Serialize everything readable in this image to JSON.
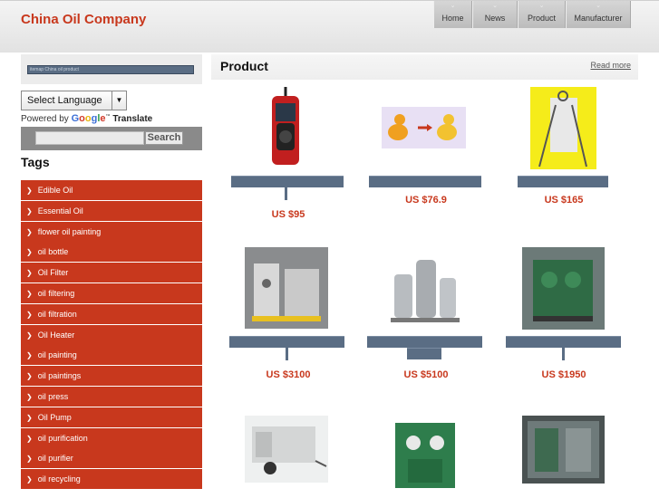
{
  "header": {
    "logo": "China Oil Company",
    "nav": [
      "Home",
      "News",
      "Product",
      "Manufacturer"
    ]
  },
  "sidebar": {
    "search_placeholder": "itemap China oil product",
    "language_select": "Select Language",
    "powered_by": "Powered by",
    "google": "Google",
    "translate": "Translate",
    "search_button": "Search",
    "tags_title": "Tags",
    "tags": [
      "Edible Oil",
      "Essential Oil",
      "flower oil painting",
      "oil bottle",
      "Oil Filter",
      "oil filtering",
      "oil filtration",
      "Oil Heater",
      "oil painting",
      "oil paintings",
      "oil press",
      "Oil Pump",
      "oil purification",
      "oil purifier",
      "oil recycling"
    ]
  },
  "main": {
    "title": "Product",
    "read_more": "Read more",
    "products": [
      {
        "price": "US $95",
        "icon": "obd-scanner-icon"
      },
      {
        "price": "US $76.9",
        "icon": "ducks-icon"
      },
      {
        "price": "US $165",
        "icon": "paper-stand-icon"
      },
      {
        "price": "US $3100",
        "icon": "oil-purifier-icon"
      },
      {
        "price": "US $5100",
        "icon": "oil-filter-machine-icon"
      },
      {
        "price": "US $1950",
        "icon": "green-purifier-icon"
      },
      {
        "price": "",
        "icon": "trailer-purifier-icon"
      },
      {
        "price": "",
        "icon": "green-machine-icon"
      },
      {
        "price": "",
        "icon": "enclosed-purifier-icon"
      }
    ]
  },
  "colors": {
    "accent": "#c8381d",
    "bar": "#5a6d84"
  }
}
